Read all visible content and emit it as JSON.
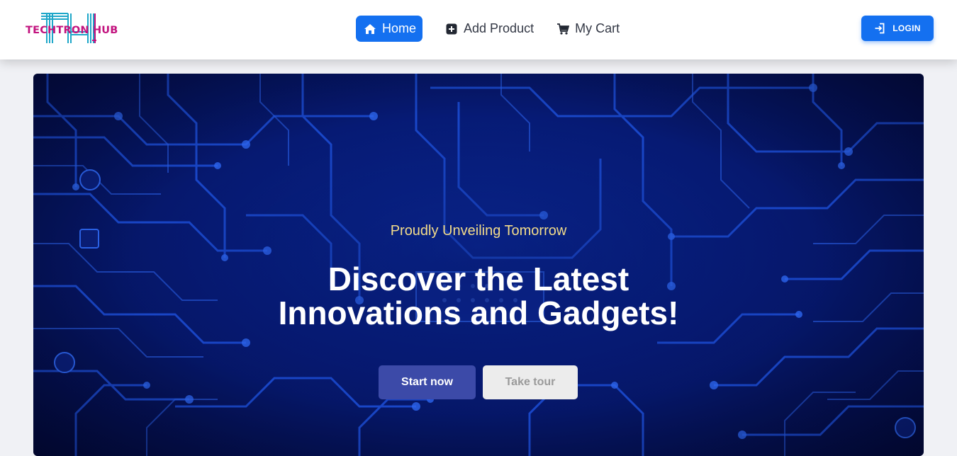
{
  "brand": {
    "name": "TECHTRON HUB",
    "colors": {
      "primary": "#1470f0",
      "logo_pink": "#c2127e",
      "logo_teal": "#1fa7c9"
    }
  },
  "nav": {
    "items": [
      {
        "label": "Home",
        "icon": "home-icon",
        "active": true
      },
      {
        "label": "Add Product",
        "icon": "plus-square-icon",
        "active": false
      },
      {
        "label": "My Cart",
        "icon": "cart-icon",
        "active": false
      }
    ],
    "login": {
      "label": "LOGIN",
      "icon": "login-icon"
    }
  },
  "hero": {
    "subtitle": "Proudly Unveiling Tomorrow",
    "title_line1": "Discover the Latest",
    "title_line2": "Innovations and Gadgets!",
    "primary_cta": "Start now",
    "secondary_cta": "Take tour",
    "background": "circuit-board-image",
    "colors": {
      "subtitle": "#f3dc8a",
      "primary_cta_bg": "#3c4aa8",
      "secondary_cta_bg": "#ececec"
    }
  }
}
